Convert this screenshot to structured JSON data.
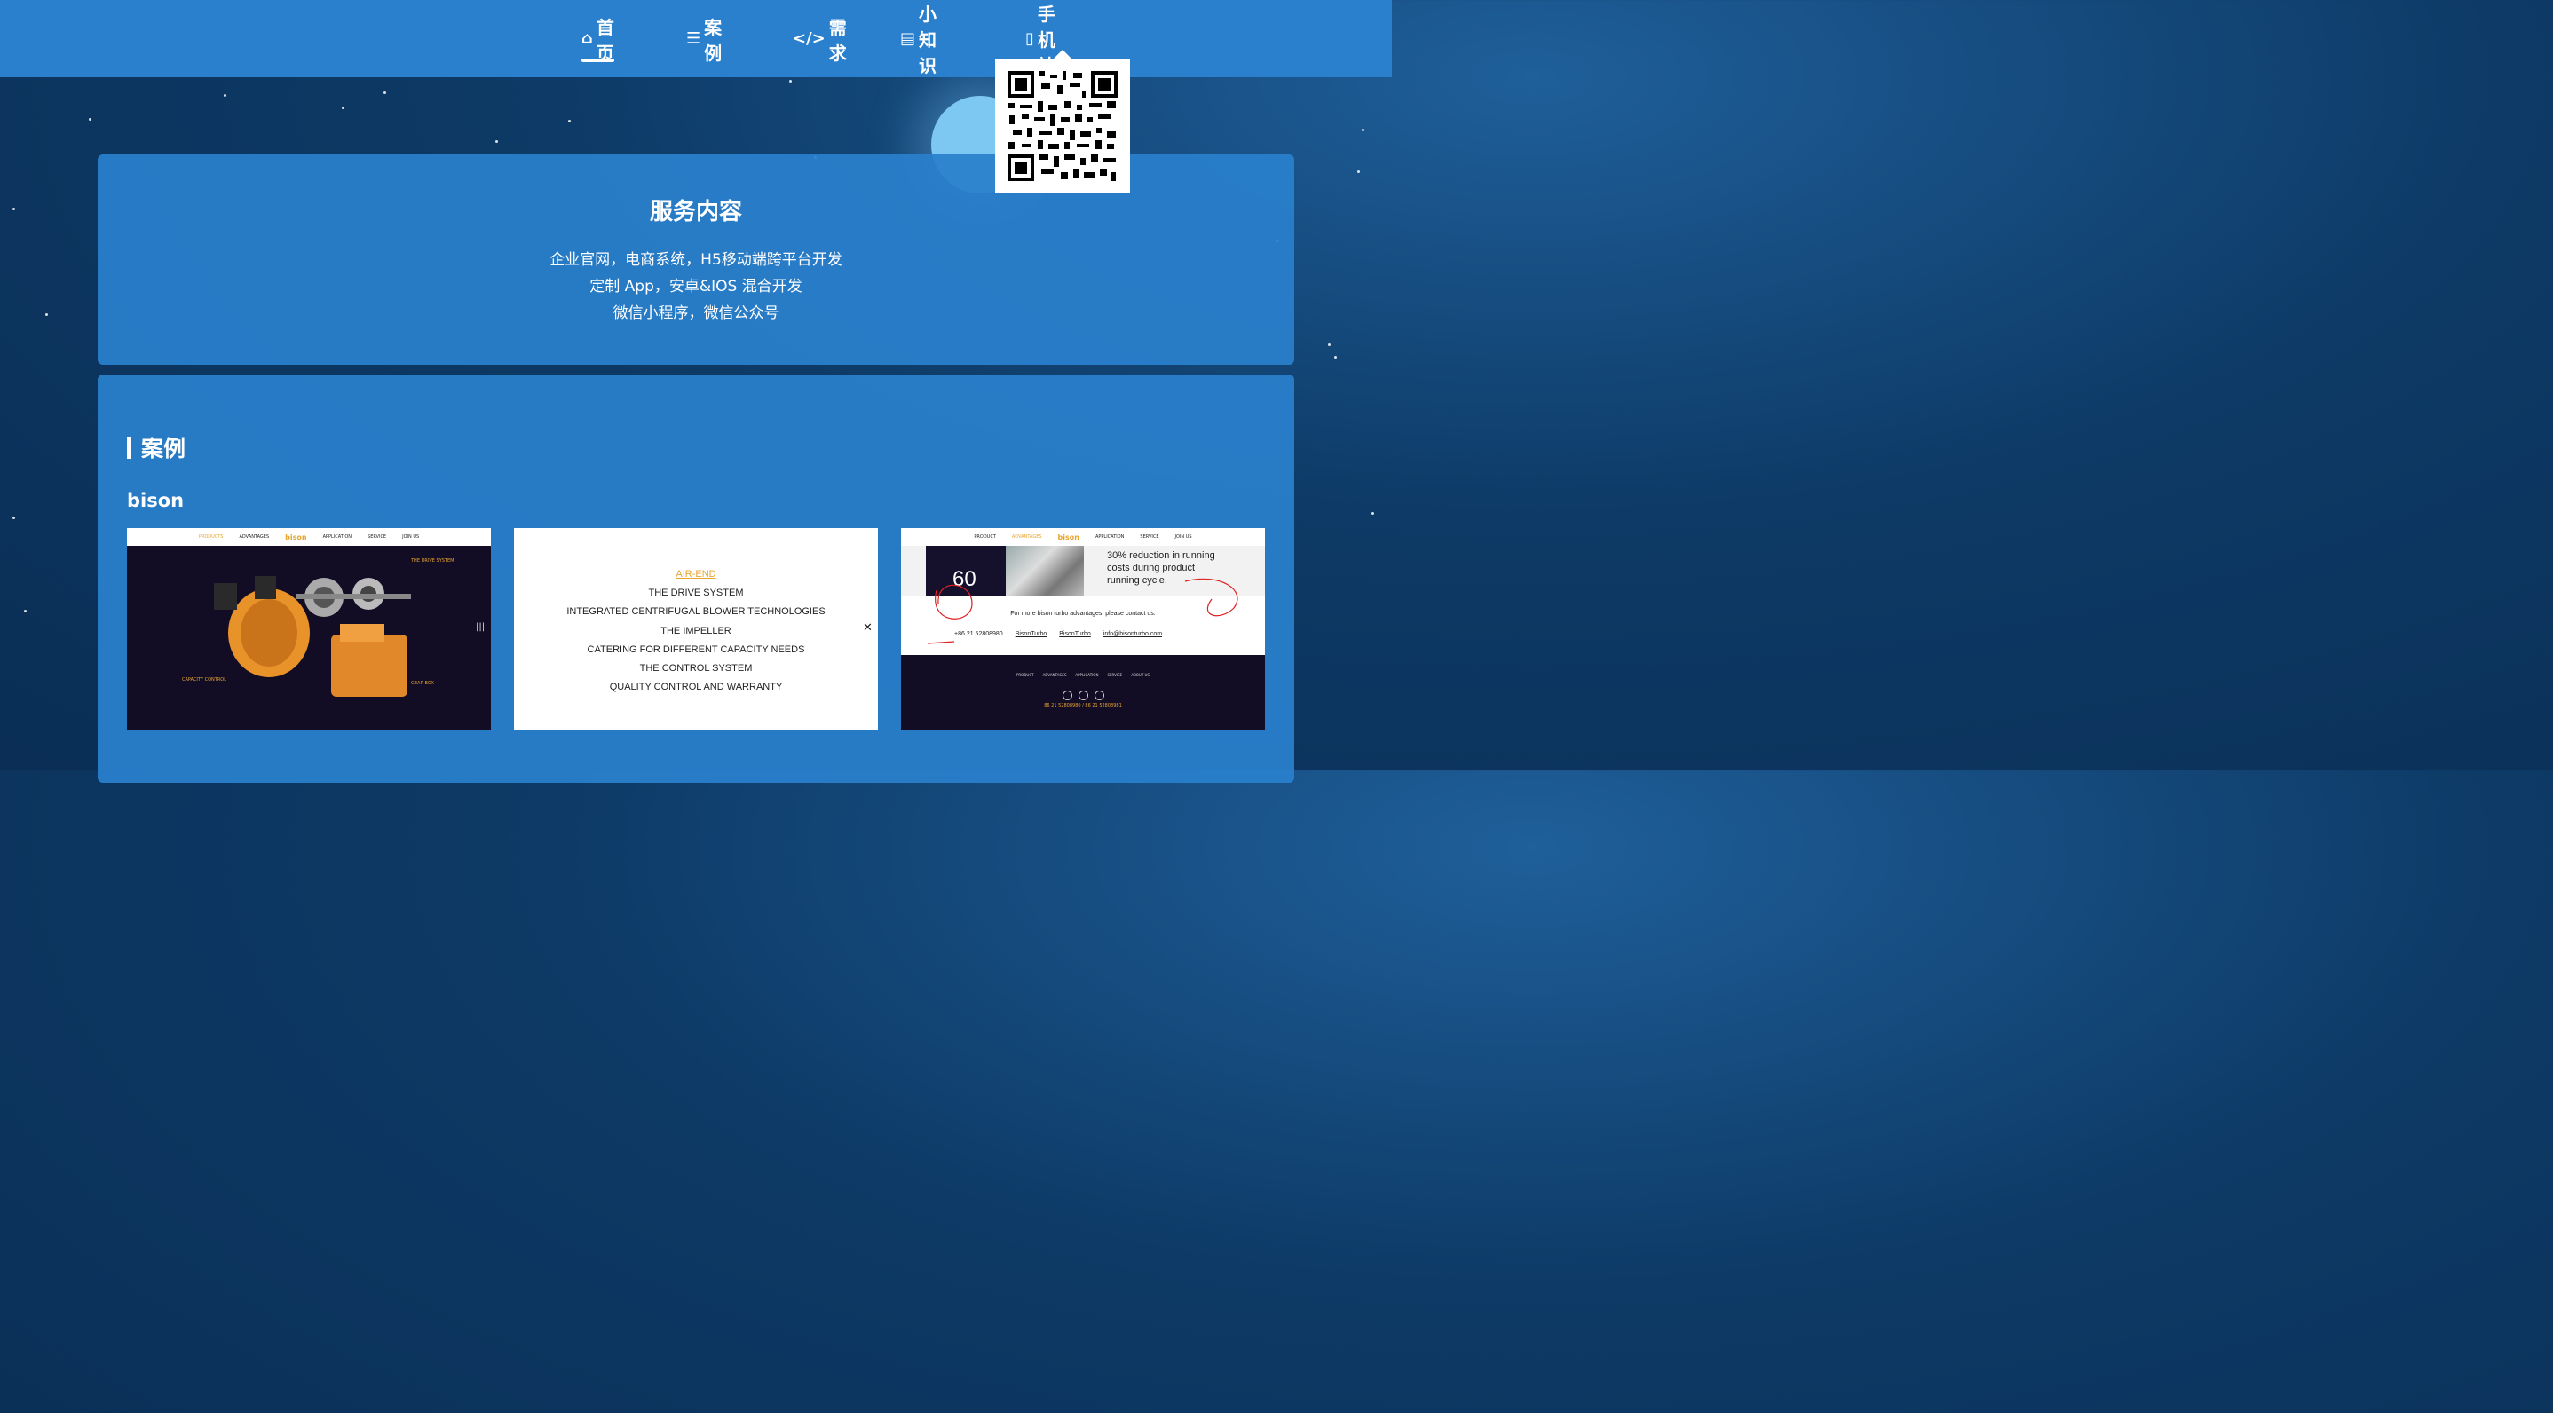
{
  "nav": {
    "items": [
      {
        "label": "首页",
        "icon": "home-icon",
        "active": true
      },
      {
        "label": "案例",
        "icon": "cases-icon",
        "active": false
      },
      {
        "label": "需求",
        "icon": "code-icon",
        "active": false
      },
      {
        "label": "小知识",
        "icon": "newspaper-icon",
        "active": false
      },
      {
        "label": "手机站",
        "icon": "mobile-icon",
        "active": false
      }
    ]
  },
  "service": {
    "title": "服务内容",
    "lines": [
      "企业官网，电商系统，H5移动端跨平台开发",
      "定制 App，安卓&IOS 混合开发",
      "微信小程序，微信公众号"
    ]
  },
  "cases": {
    "heading": "案例",
    "project": "bison",
    "shot1": {
      "nav": [
        "PRODUCTS",
        "ADVANTAGES",
        "bison",
        "APPLICATION",
        "SERVICE",
        "JOIN US"
      ],
      "labels": [
        "THE DRIVE SYSTEM",
        "CAPACITY CONTROL",
        "GEAR BOX"
      ]
    },
    "shot2": {
      "items": [
        "AIR-END",
        "THE DRIVE SYSTEM",
        "INTEGRATED CENTRIFUGAL BLOWER TECHNOLOGIES",
        "THE IMPELLER",
        "CATERING FOR DIFFERENT CAPACITY NEEDS",
        "THE CONTROL SYSTEM",
        "QUALITY CONTROL AND WARRANTY"
      ]
    },
    "shot3": {
      "nav": [
        "PRODUCT",
        "ADVANTAGES",
        "bison",
        "APPLICATION",
        "SERVICE",
        "JOIN US"
      ],
      "big_number": "60",
      "cost_text": [
        "30% reduction in running",
        "costs during product",
        "running cycle."
      ],
      "more": "For more bison turbo advantages, please contact us.",
      "phone": "+86 21 52808980",
      "wechat": "BisonTurbo",
      "linkedin": "BisonTurbo",
      "email": "info@bisonturbo.com",
      "footer_nav": [
        "PRODUCT",
        "ADVANTAGES",
        "APPLICATION",
        "SERVICE",
        "ABOUT US"
      ],
      "footer_phone": "86 21 52808980 / 86 21 52808981"
    }
  },
  "colors": {
    "header": "#2a80cc",
    "panel": "#2a80cc",
    "accent": "#e8a530"
  }
}
